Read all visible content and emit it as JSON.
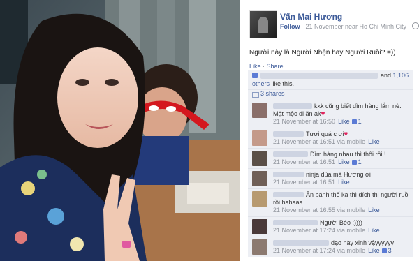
{
  "post": {
    "author": "Vấn Mai Hương",
    "follow_label": "Follow",
    "meta_rest": " · 21 November near Ho Chi Minh City ·",
    "text": "Người này là Người Nhện hay Người Ruồi? =))",
    "like_action": "Like",
    "share_action": "Share",
    "likes_and": "and",
    "likes_count": "1,106",
    "likes_others": "others",
    "likes_suffix": " like this.",
    "shares_label": "3 shares"
  },
  "comments": [
    {
      "text": "kkk cũng biết dìm hàng lắm nè. Mặt mộc đi ăn ak",
      "time": "21 November at 16:50",
      "via": "",
      "like": "Like",
      "count": "1",
      "heart": true
    },
    {
      "text": "Tươi quá c ơi",
      "time": "21 November at 16:51 via mobile",
      "via": "",
      "like": "Like",
      "count": "",
      "heart": true
    },
    {
      "text": "Dìm hàng nhau thì thôi rồi !",
      "time": "21 November at 16:51",
      "via": "",
      "like": "Like",
      "count": "1",
      "heart": false
    },
    {
      "text": "ninja dùa mà Hương ơi",
      "time": "21 November at 16:51",
      "via": "",
      "like": "Like",
      "count": "",
      "heart": false
    },
    {
      "text": "Ăn bánh thế ka thì đích thị người ruồi rồi hahaaa",
      "time": "21 November at 16:55 via mobile",
      "via": "",
      "like": "Like",
      "count": "",
      "heart": false
    },
    {
      "text": "Người Béo :))))",
      "time": "21 November at 17:24 via mobile",
      "via": "",
      "like": "Like",
      "count": "",
      "heart": false
    },
    {
      "text": "dạo này xinh vậyyyyyy",
      "time": "21 November at 17:24 via mobile",
      "via": "",
      "like": "Like",
      "count": "3",
      "heart": false
    }
  ]
}
